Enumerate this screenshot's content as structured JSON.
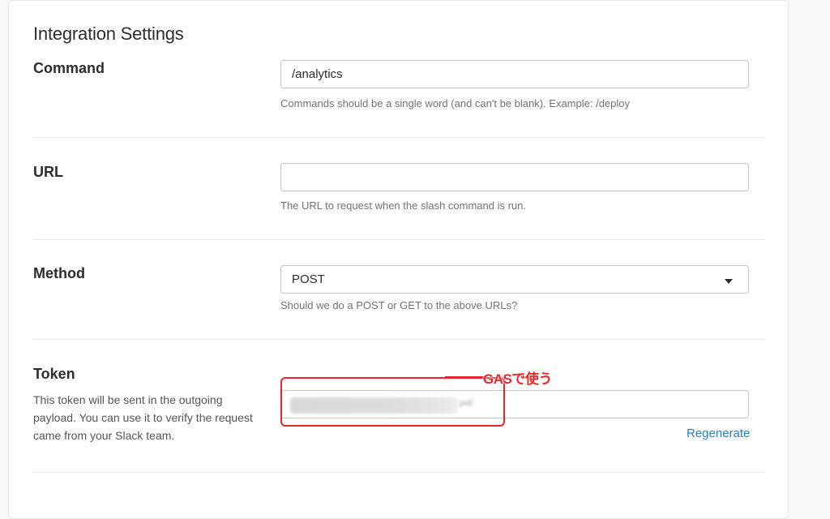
{
  "section_title": "Integration Settings",
  "command": {
    "label": "Command",
    "value": "/analytics",
    "hint": "Commands should be a single word (and can't be blank). Example: /deploy"
  },
  "url": {
    "label": "URL",
    "value": "",
    "hint": "The URL to request when the slash command is run."
  },
  "method": {
    "label": "Method",
    "selected": "POST",
    "hint": "Should we do a POST or GET to the above URLs?"
  },
  "token": {
    "label": "Token",
    "description": "This token will be sent in the outgoing payload. You can use it to verify the request came from your Slack team.",
    "value_obscured_tail": "pxE",
    "regenerate_label": "Regenerate"
  },
  "annotation": {
    "text": "GASで使う",
    "color": "#e8252b"
  },
  "colors": {
    "link": "#2a80b9",
    "text": "#2c2d30",
    "hint": "#717274"
  },
  "icons": {
    "method_dropdown": "caret-down-icon"
  }
}
